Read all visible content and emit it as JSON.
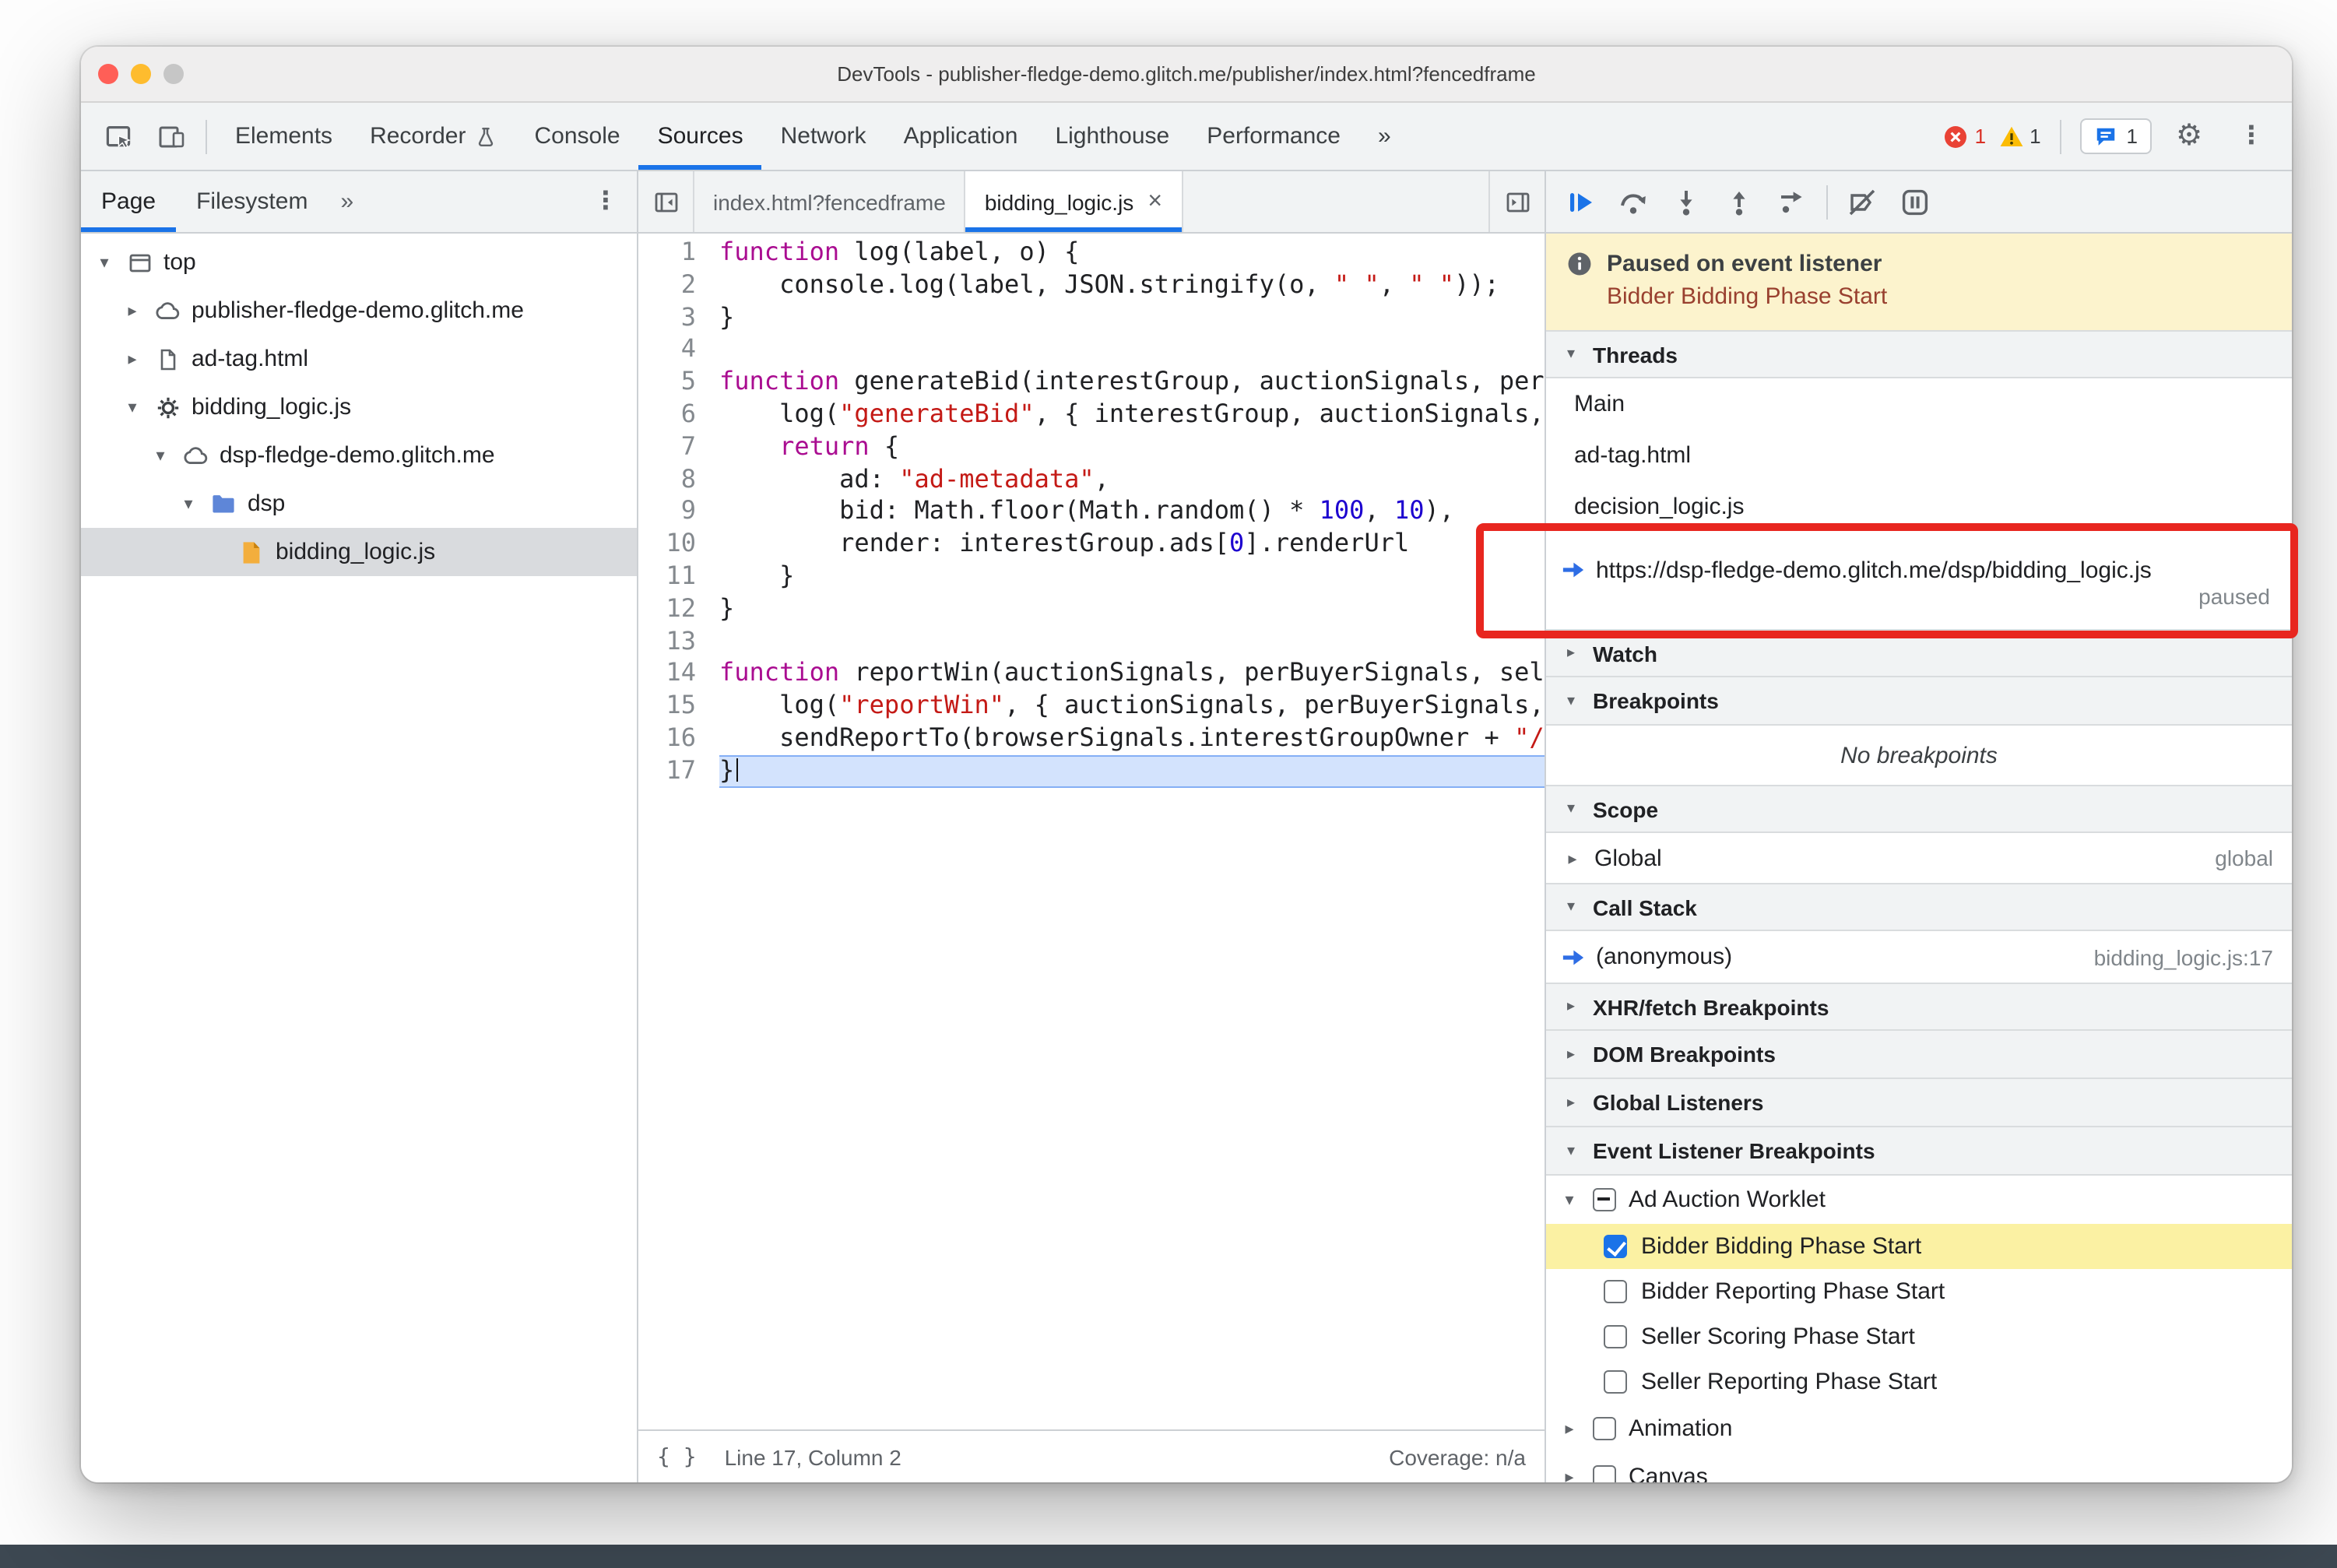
{
  "window": {
    "title": "DevTools - publisher-fledge-demo.glitch.me/publisher/index.html?fencedframe"
  },
  "toolbar": {
    "tabs": [
      {
        "label": "Elements"
      },
      {
        "label": "Recorder",
        "icon": "flask-icon"
      },
      {
        "label": "Console"
      },
      {
        "label": "Sources",
        "active": true
      },
      {
        "label": "Network"
      },
      {
        "label": "Application"
      },
      {
        "label": "Lighthouse"
      },
      {
        "label": "Performance"
      }
    ],
    "more_tabs": "»",
    "errors": {
      "count": "1"
    },
    "warnings": {
      "count": "1"
    },
    "issues": {
      "count": "1"
    }
  },
  "sidebar": {
    "tabs": [
      {
        "label": "Page",
        "active": true
      },
      {
        "label": "Filesystem"
      }
    ],
    "more_tabs": "»",
    "tree": [
      {
        "label": "top",
        "icon": "frame-icon",
        "state": "expanded",
        "level": 0
      },
      {
        "label": "publisher-fledge-demo.glitch.me",
        "icon": "cloud-icon",
        "state": "collapsed",
        "level": 1
      },
      {
        "label": "ad-tag.html",
        "icon": "document-icon",
        "state": "collapsed",
        "level": 1
      },
      {
        "label": "bidding_logic.js",
        "icon": "worklet-gear-icon",
        "state": "expanded",
        "level": 1
      },
      {
        "label": "dsp-fledge-demo.glitch.me",
        "icon": "cloud-icon",
        "state": "expanded",
        "level": 2
      },
      {
        "label": "dsp",
        "icon": "folder-icon",
        "state": "expanded",
        "level": 3
      },
      {
        "label": "bidding_logic.js",
        "icon": "js-file-icon",
        "state": "leaf",
        "level": 4,
        "selected": true
      }
    ]
  },
  "editor": {
    "tabs": [
      {
        "label": "index.html?fencedframe"
      },
      {
        "label": "bidding_logic.js",
        "active": true,
        "closable": true
      }
    ],
    "active_line": 17,
    "lines": [
      {
        "n": 1,
        "tokens": [
          [
            "k",
            "function"
          ],
          [
            "p",
            " log(label, o) {"
          ]
        ]
      },
      {
        "n": 2,
        "tokens": [
          [
            "p",
            "    console.log(label, JSON.stringify(o, "
          ],
          [
            "s",
            "\" \""
          ],
          [
            "p",
            ", "
          ],
          [
            "s",
            "\" \""
          ],
          [
            "p",
            "));"
          ]
        ]
      },
      {
        "n": 3,
        "tokens": [
          [
            "p",
            "}"
          ]
        ]
      },
      {
        "n": 4,
        "tokens": []
      },
      {
        "n": 5,
        "tokens": [
          [
            "k",
            "function"
          ],
          [
            "p",
            " generateBid(interestGroup, auctionSignals, perBuyerSignals, trustedBiddingSignals, browserSignals) {"
          ]
        ]
      },
      {
        "n": 6,
        "tokens": [
          [
            "p",
            "    log("
          ],
          [
            "s",
            "\"generateBid\""
          ],
          [
            "p",
            ", { interestGroup, auctionSignals, perBuyerSignals });"
          ]
        ]
      },
      {
        "n": 7,
        "tokens": [
          [
            "p",
            "    "
          ],
          [
            "k",
            "return"
          ],
          [
            "p",
            " {"
          ]
        ]
      },
      {
        "n": 8,
        "tokens": [
          [
            "p",
            "        ad: "
          ],
          [
            "s",
            "\"ad-metadata\""
          ],
          [
            "p",
            ","
          ]
        ]
      },
      {
        "n": 9,
        "tokens": [
          [
            "p",
            "        bid: Math.floor(Math.random() * "
          ],
          [
            "n",
            "100"
          ],
          [
            "p",
            ", "
          ],
          [
            "n",
            "10"
          ],
          [
            "p",
            "),"
          ]
        ]
      },
      {
        "n": 10,
        "tokens": [
          [
            "p",
            "        render: interestGroup.ads["
          ],
          [
            "n",
            "0"
          ],
          [
            "p",
            "].renderUrl"
          ]
        ]
      },
      {
        "n": 11,
        "tokens": [
          [
            "p",
            "    }"
          ]
        ]
      },
      {
        "n": 12,
        "tokens": [
          [
            "p",
            "}"
          ]
        ]
      },
      {
        "n": 13,
        "tokens": []
      },
      {
        "n": 14,
        "tokens": [
          [
            "k",
            "function"
          ],
          [
            "p",
            " reportWin(auctionSignals, perBuyerSignals, sellerSignals, browserSignals) {"
          ]
        ]
      },
      {
        "n": 15,
        "tokens": [
          [
            "p",
            "    log("
          ],
          [
            "s",
            "\"reportWin\""
          ],
          [
            "p",
            ", { auctionSignals, perBuyerSignals, sellerSignals });"
          ]
        ]
      },
      {
        "n": 16,
        "tokens": [
          [
            "p",
            "    sendReportTo(browserSignals.interestGroupOwner + "
          ],
          [
            "s",
            "\"/report/win\""
          ],
          [
            "p",
            ");"
          ]
        ]
      },
      {
        "n": 17,
        "tokens": [
          [
            "p",
            "}"
          ]
        ],
        "cursor_after": true
      }
    ],
    "status": {
      "pretty_print": "{ }",
      "position": "Line 17, Column 2",
      "coverage": "Coverage: n/a"
    }
  },
  "debugger": {
    "toolbar_icons": [
      "resume-icon",
      "step-over-icon",
      "step-into-icon",
      "step-out-icon",
      "step-icon",
      "sep",
      "deactivate-breakpoints-icon",
      "pause-on-exceptions-icon"
    ],
    "paused_banner": {
      "title": "Paused on event listener",
      "event": "Bidder Bidding Phase Start"
    },
    "sections": {
      "threads": {
        "title": "Threads",
        "items": [
          {
            "label": "Main"
          },
          {
            "label": "ad-tag.html"
          },
          {
            "label": "decision_logic.js"
          },
          {
            "label": "https://dsp-fledge-demo.glitch.me/dsp/bidding_logic.js",
            "current": true,
            "status": "paused"
          }
        ]
      },
      "watch": {
        "title": "Watch",
        "collapsed": true
      },
      "breakpoints": {
        "title": "Breakpoints",
        "empty_message": "No breakpoints"
      },
      "scope": {
        "title": "Scope",
        "rows": [
          {
            "label": "Global",
            "right": "global"
          }
        ]
      },
      "call_stack": {
        "title": "Call Stack",
        "rows": [
          {
            "label": "(anonymous)",
            "right": "bidding_logic.js:17",
            "current": true
          }
        ]
      },
      "xhr": {
        "title": "XHR/fetch Breakpoints",
        "collapsed": true
      },
      "dom": {
        "title": "DOM Breakpoints",
        "collapsed": true
      },
      "global_listeners": {
        "title": "Global Listeners",
        "collapsed": true
      },
      "event_listener_breakpoints": {
        "title": "Event Listener Breakpoints",
        "groups": [
          {
            "label": "Ad Auction Worklet",
            "checkbox": "indeterminate",
            "expanded": true,
            "children": [
              {
                "label": "Bidder Bidding Phase Start",
                "checkbox": "checked",
                "highlighted": true
              },
              {
                "label": "Bidder Reporting Phase Start",
                "checkbox": "unchecked"
              },
              {
                "label": "Seller Scoring Phase Start",
                "checkbox": "unchecked"
              },
              {
                "label": "Seller Reporting Phase Start",
                "checkbox": "unchecked"
              }
            ]
          },
          {
            "label": "Animation",
            "checkbox": "unchecked",
            "expanded": false,
            "children": []
          },
          {
            "label": "Canvas",
            "checkbox": "unchecked",
            "expanded": false,
            "children": []
          }
        ]
      }
    }
  },
  "annotation": {
    "color": "#e8261f"
  },
  "colors": {
    "accent": "#1a73e8",
    "error": "#d93025",
    "warning": "#f9ab00",
    "paused_banner_bg": "#fcf3cd",
    "highlight_row": "#fbf1a3"
  }
}
